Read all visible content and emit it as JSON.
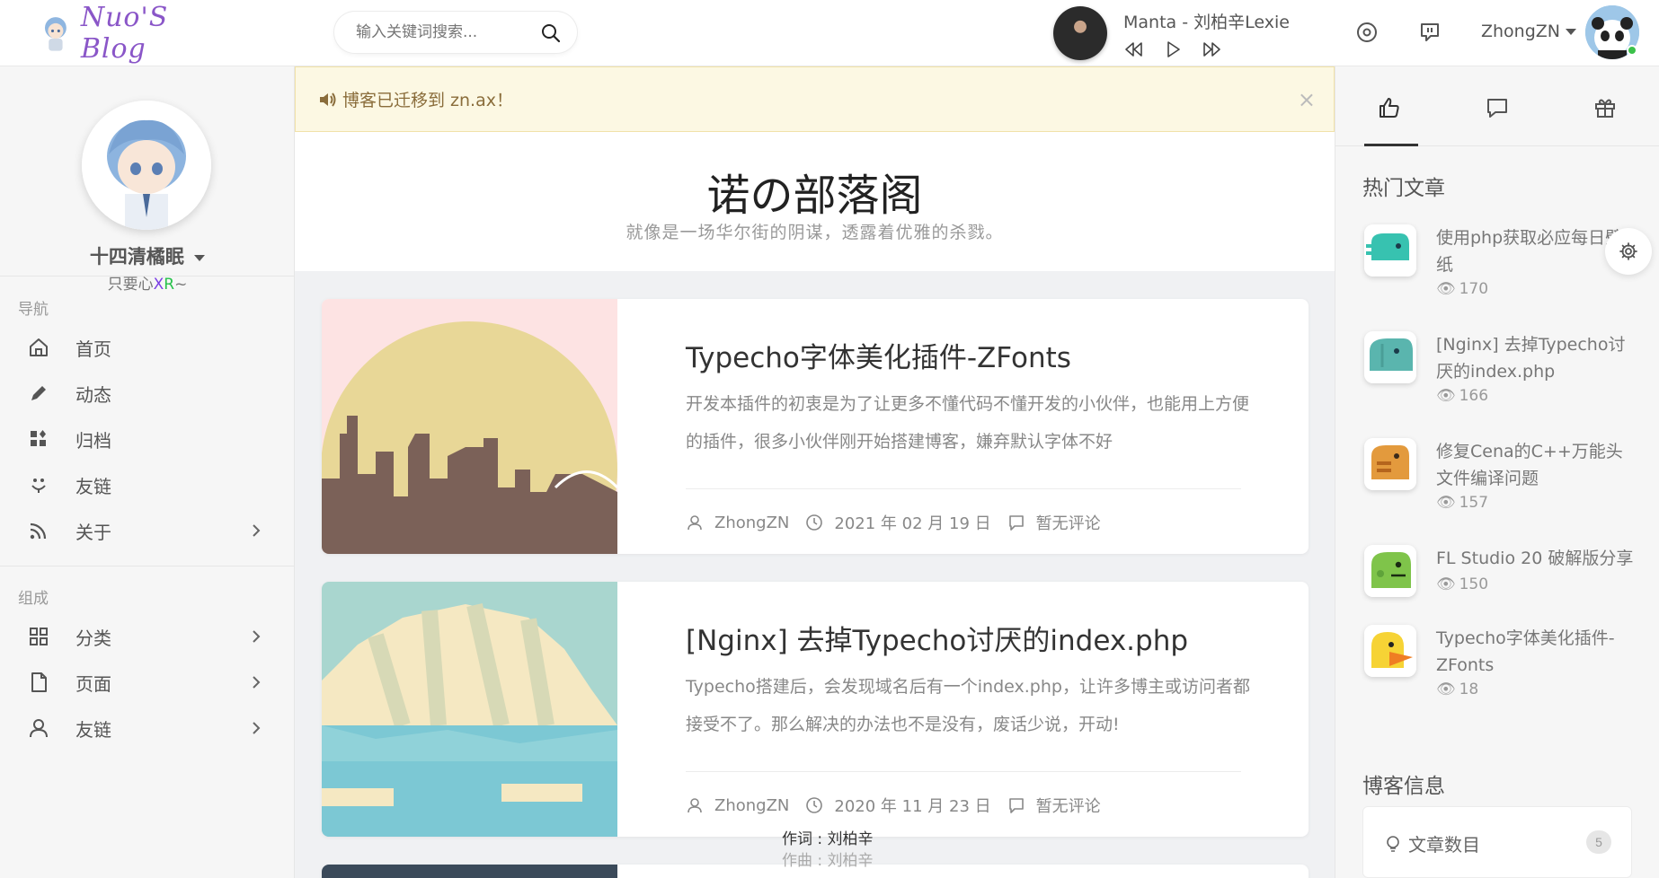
{
  "header": {
    "logo_text": "Nuo'S Blog",
    "search_placeholder": "输入关键词搜索...",
    "player": {
      "song": "Manta - 刘柏辛Lexie"
    },
    "username": "ZhongZN"
  },
  "notice": {
    "text": "博客已迁移到 zn.ax！",
    "close": "×"
  },
  "profile": {
    "name": "十四清橘眠",
    "sub_prefix": "只要心",
    "sub_x": "X",
    "sub_r": "R",
    "sub_suffix": "~"
  },
  "nav": {
    "heading1": "导航",
    "heading2": "组成",
    "items": [
      {
        "label": "首页",
        "icon": "home-icon"
      },
      {
        "label": "动态",
        "icon": "pencil-icon"
      },
      {
        "label": "归档",
        "icon": "grid-icon"
      },
      {
        "label": "友链",
        "icon": "link-icon"
      },
      {
        "label": "关于",
        "icon": "rss-icon"
      }
    ],
    "items2": [
      {
        "label": "分类",
        "icon": "category-icon"
      },
      {
        "label": "页面",
        "icon": "page-icon"
      },
      {
        "label": "友链",
        "icon": "user-icon"
      }
    ]
  },
  "main": {
    "title": "诺の部落阁",
    "subtitle": "就像是一场华尔街的阴谋，透露着优雅的杀戮。",
    "posts": [
      {
        "title": "Typecho字体美化插件-ZFonts",
        "excerpt": "开发本插件的初衷是为了让更多不懂代码不懂开发的小伙伴，也能用上方便的插件，很多小伙伴刚开始搭建博客，嫌弃默认字体不好",
        "author": "ZhongZN",
        "date": "2021 年 02 月 19 日",
        "comments": "暂无评论"
      },
      {
        "title": "[Nginx] 去掉Typecho讨厌的index.php",
        "excerpt": "Typecho搭建后，会发现域名后有一个index.php，让许多博主或访问者都接受不了。那么解决的办法也不是没有，废话少说，开动!",
        "author": "ZhongZN",
        "date": "2020 年 11 月 23 日",
        "comments": "暂无评论"
      }
    ],
    "lyric_line1": "作词 : 刘柏辛",
    "lyric_line2": "作曲 : 刘柏辛"
  },
  "right": {
    "hot_title": "热门文章",
    "hot": [
      {
        "title": "使用php获取必应每日壁纸",
        "views": "170"
      },
      {
        "title": "[Nginx] 去掉Typecho讨厌的index.php",
        "views": "166"
      },
      {
        "title": "修复Cena的C++万能头文件编译问题",
        "views": "157"
      },
      {
        "title": "FL Studio 20 破解版分享",
        "views": "150"
      },
      {
        "title": "Typecho字体美化插件-ZFonts",
        "views": "18"
      }
    ],
    "info_title": "博客信息",
    "info_label": "文章数目",
    "info_count": "5"
  },
  "colors": {
    "notice_bg": "#fcf8e3",
    "notice_text": "#8a6d3b",
    "logo": "#8a56c8",
    "online": "#3bc14a"
  }
}
